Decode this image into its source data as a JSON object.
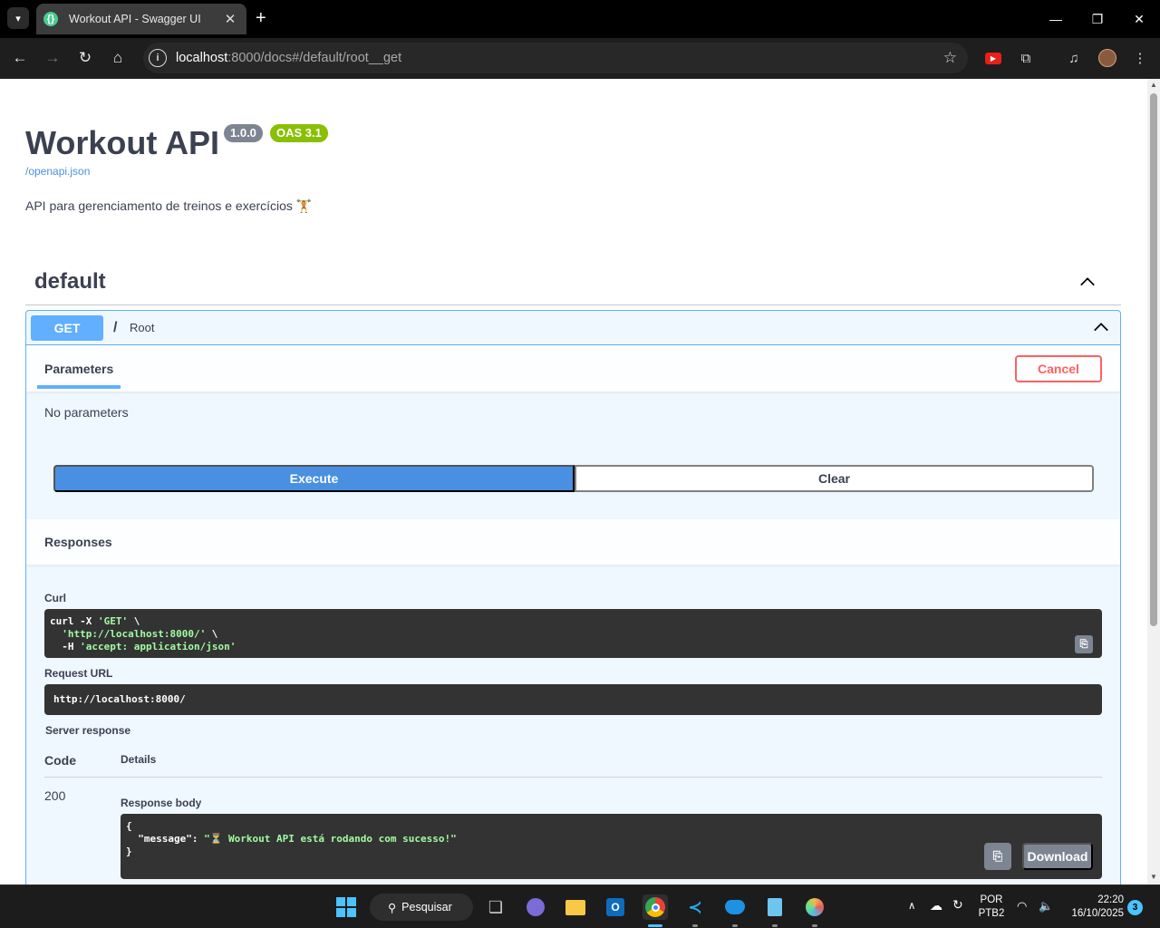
{
  "browser": {
    "tab_title": "Workout API - Swagger UI",
    "url_host": "localhost",
    "url_rest": ":8000/docs#/default/root__get"
  },
  "info": {
    "title": "Workout API",
    "version": "1.0.0",
    "oas": "OAS 3.1",
    "spec_link": "/openapi.json",
    "description": "API para gerenciamento de treinos e exercícios 🏋️"
  },
  "tag": {
    "name": "default"
  },
  "operation": {
    "method": "GET",
    "path": "/",
    "summary": "Root",
    "parameters_tab": "Parameters",
    "cancel_label": "Cancel",
    "no_params": "No parameters",
    "execute_label": "Execute",
    "clear_label": "Clear"
  },
  "responses": {
    "title": "Responses",
    "curl_label": "Curl",
    "curl_lines": {
      "l1_cmd": "curl -X ",
      "l1_str": "'GET'",
      "l1_end": " \\",
      "l2_str": "  'http://localhost:8000/'",
      "l2_end": " \\",
      "l3_cmd": "  -H ",
      "l3_str": "'accept: application/json'"
    },
    "request_url_label": "Request URL",
    "request_url": "http://localhost:8000/",
    "server_response_label": "Server response",
    "code_header": "Code",
    "details_header": "Details",
    "status_code": "200",
    "body_label": "Response body",
    "body_lines": {
      "open": "{",
      "key": "  \"message\": ",
      "value": "\"⏳ Workout API está rodando com sucesso!\"",
      "close": "}"
    },
    "download_label": "Download"
  },
  "taskbar": {
    "search_label": "Pesquisar",
    "lang_top": "POR",
    "lang_bottom": "PTB2",
    "time": "22:20",
    "date": "16/10/2025",
    "notification_count": "3"
  },
  "colors": {
    "get": "#61affe",
    "execute": "#4990e2",
    "cancel": "#ff6060",
    "version_badge": "#7d8492",
    "oas_badge": "#89bf04",
    "text": "#3b4151"
  }
}
